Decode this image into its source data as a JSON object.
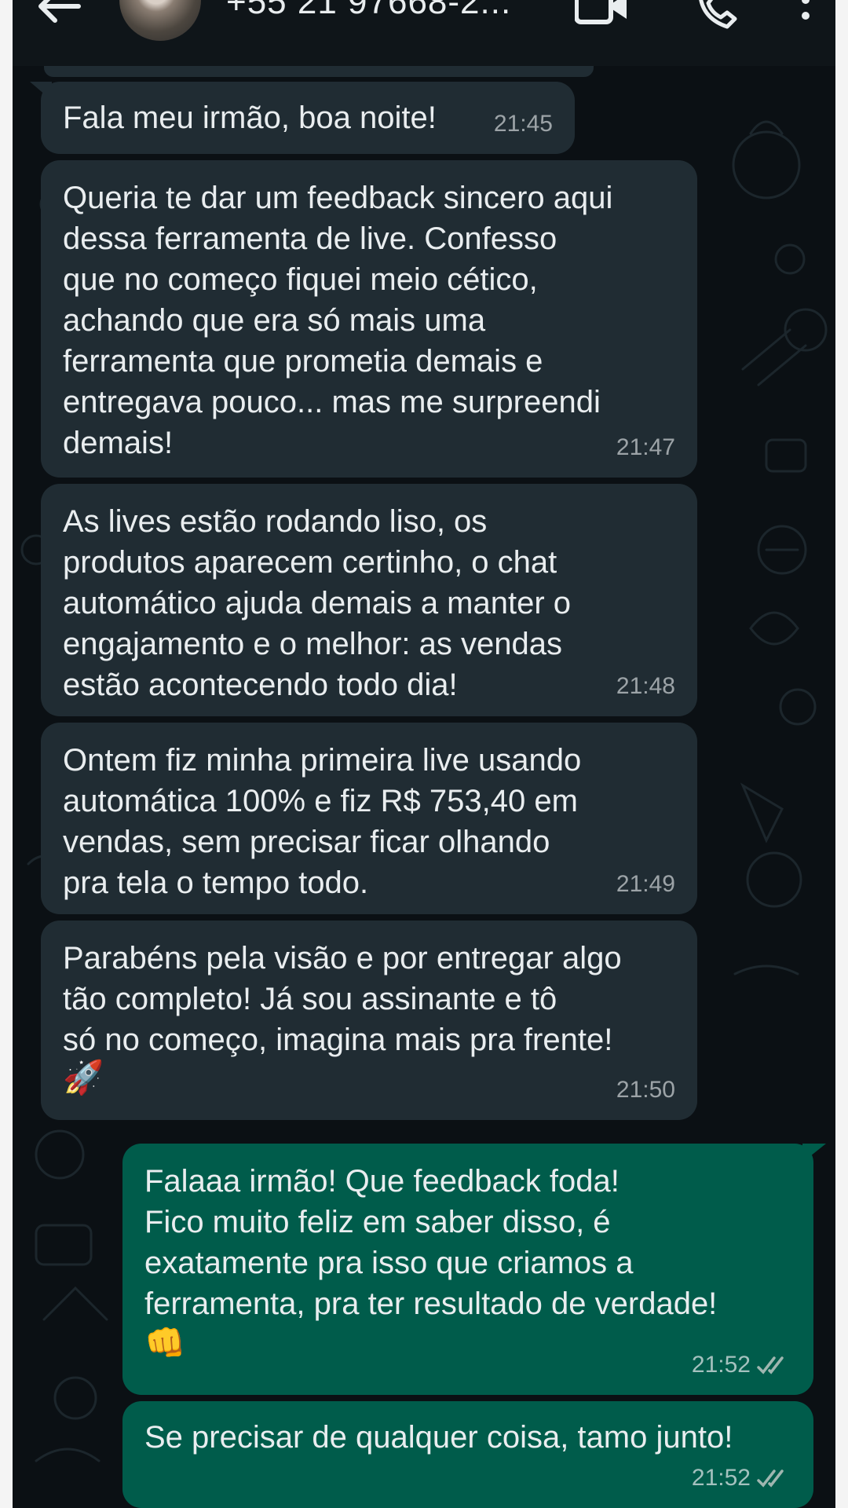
{
  "header": {
    "contact_name": "+55 21 97668-2...",
    "icons": [
      "back-arrow-icon",
      "avatar",
      "video-call-icon",
      "voice-call-icon",
      "more-vert-icon"
    ]
  },
  "messages": [
    {
      "direction": "in",
      "text": "Fala meu irmão, boa noite!",
      "time": "21:45"
    },
    {
      "direction": "in",
      "text": "Queria te dar um feedback sincero aqui\ndessa ferramenta de live. Confesso\nque no começo fiquei meio cético,\nachando que era só mais uma\nferramenta que prometia demais e\nentregava pouco... mas me surpreendi\ndemais!",
      "time": "21:47"
    },
    {
      "direction": "in",
      "text": "As lives estão rodando liso, os\nprodutos aparecem certinho, o chat\nautomático ajuda demais a manter o\nengajamento e o melhor: as vendas\nestão acontecendo todo dia!",
      "time": "21:48"
    },
    {
      "direction": "in",
      "text": "Ontem fiz minha primeira live usando\nautomática 100% e fiz R$ 753,40 em\nvendas, sem precisar ficar olhando\npra tela o tempo todo.",
      "time": "21:49"
    },
    {
      "direction": "in",
      "text": "Parabéns pela visão e por entregar algo\ntão completo! Já sou assinante e tô\nsó no começo, imagina mais pra frente!",
      "emoji": "🚀",
      "time": "21:50"
    },
    {
      "direction": "out",
      "text": "Falaaa irmão! Que feedback foda!\nFico muito feliz em saber disso, é\nexatamente pra isso que criamos a\nferramenta, pra ter resultado de verdade!",
      "emoji": "👊",
      "time": "21:52",
      "status": "read"
    },
    {
      "direction": "out",
      "text": "Se precisar de qualquer coisa, tamo junto!",
      "time": "21:52",
      "status": "read"
    }
  ],
  "colors": {
    "background": "#0b1014",
    "incoming_bubble": "#202c33",
    "outgoing_bubble": "#005c4b",
    "text": "#e9edef",
    "read_ticks": "#9fb6b0"
  }
}
